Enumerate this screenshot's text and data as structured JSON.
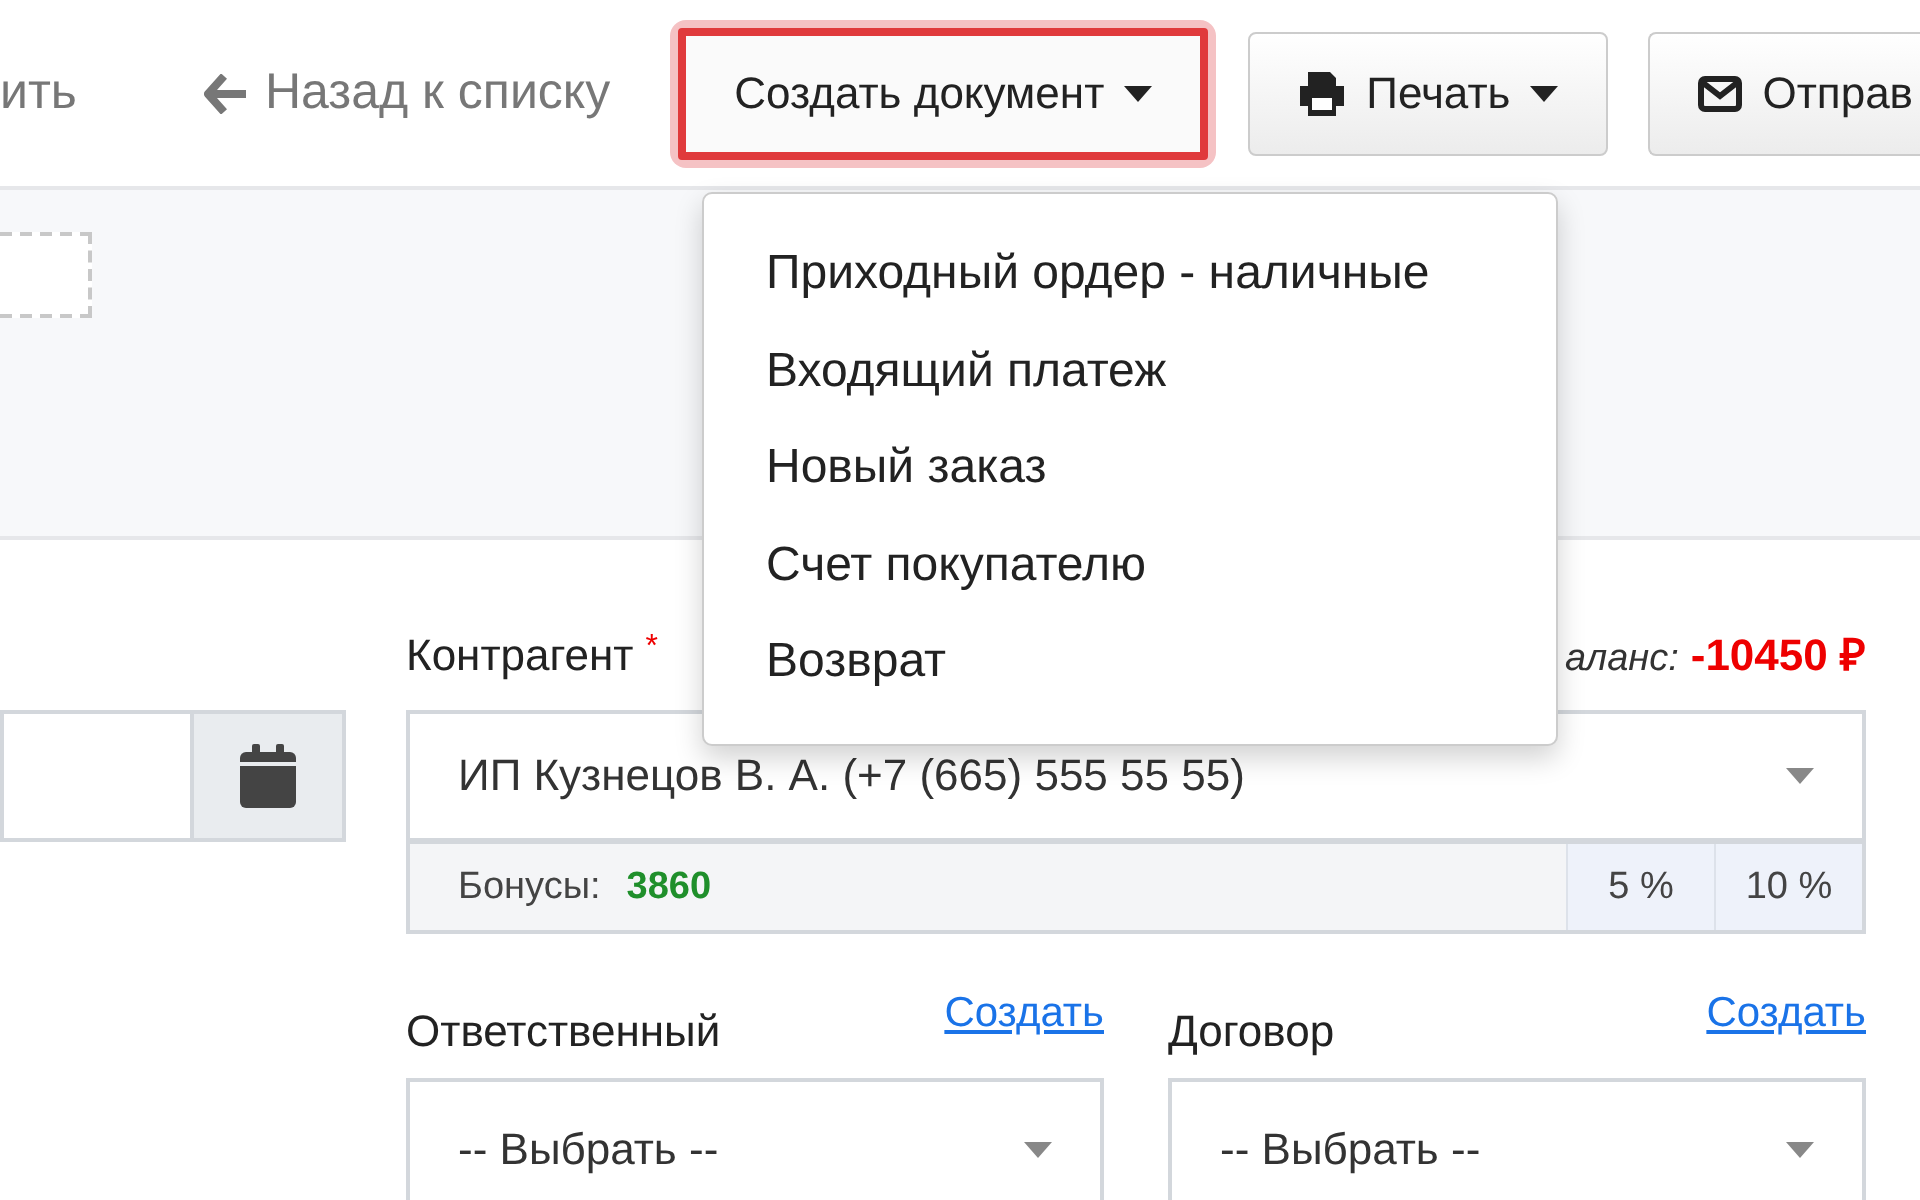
{
  "toolbar": {
    "cut_label": "ить",
    "back_link": "Назад к списку",
    "create_button": {
      "label": "Создать документ",
      "open": true
    },
    "print_button": "Печать",
    "send_button": "Отправ"
  },
  "dropdown": {
    "items": [
      "Приходный ордер - наличные",
      "Входящий платеж",
      "Новый заказ",
      "Счет покупателю",
      "Возврат"
    ]
  },
  "counterparty": {
    "label": "Контрагент",
    "required_mark": "*",
    "balance_label": "аланс:",
    "balance_value": "-10450 ₽",
    "value": "ИП Кузнецов В. А. (+7 (665) 555 55 55)",
    "bonus_label": "Бонусы:",
    "bonus_value": "3860",
    "discounts": [
      "5 %",
      "10 %"
    ]
  },
  "selects": [
    {
      "label": "Ответственный",
      "create_link": "Создать",
      "value": "-- Выбрать --"
    },
    {
      "label": "Договор",
      "create_link": "Создать",
      "value": "-- Выбрать --"
    }
  ]
}
